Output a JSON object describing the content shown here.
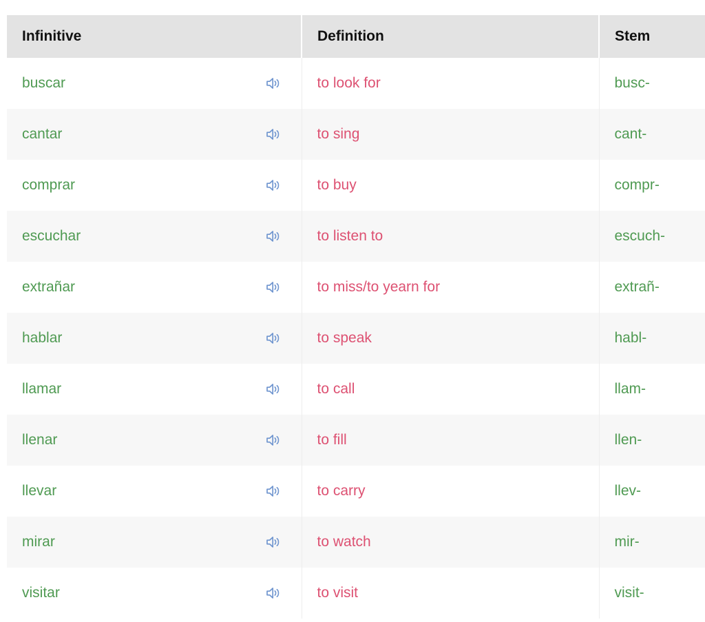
{
  "table": {
    "columns": [
      {
        "key": "infinitive",
        "label": "Infinitive"
      },
      {
        "key": "definition",
        "label": "Definition"
      },
      {
        "key": "stem",
        "label": "Stem"
      }
    ],
    "audio_icon": "speaker-icon",
    "rows": [
      {
        "infinitive": "buscar",
        "definition": "to look for",
        "stem": "busc-"
      },
      {
        "infinitive": "cantar",
        "definition": "to sing",
        "stem": "cant-"
      },
      {
        "infinitive": "comprar",
        "definition": "to buy",
        "stem": "compr-"
      },
      {
        "infinitive": "escuchar",
        "definition": "to listen to",
        "stem": "escuch-"
      },
      {
        "infinitive": "extrañar",
        "definition": "to miss/to yearn for",
        "stem": "extrañ-"
      },
      {
        "infinitive": "hablar",
        "definition": "to speak",
        "stem": "habl-"
      },
      {
        "infinitive": "llamar",
        "definition": "to call",
        "stem": "llam-"
      },
      {
        "infinitive": "llenar",
        "definition": "to fill",
        "stem": "llen-"
      },
      {
        "infinitive": "llevar",
        "definition": "to carry",
        "stem": "llev-"
      },
      {
        "infinitive": "mirar",
        "definition": "to watch",
        "stem": "mir-"
      },
      {
        "infinitive": "visitar",
        "definition": "to visit",
        "stem": "visit-"
      }
    ]
  },
  "colors": {
    "header_background": "#e3e3e3",
    "header_text": "#111111",
    "infinitive_text": "#4f9a52",
    "definition_text": "#dd5172",
    "stem_text": "#4f9a52",
    "row_odd_background": "#ffffff",
    "row_even_background": "#f7f7f7",
    "audio_icon": "#6f95cf"
  }
}
